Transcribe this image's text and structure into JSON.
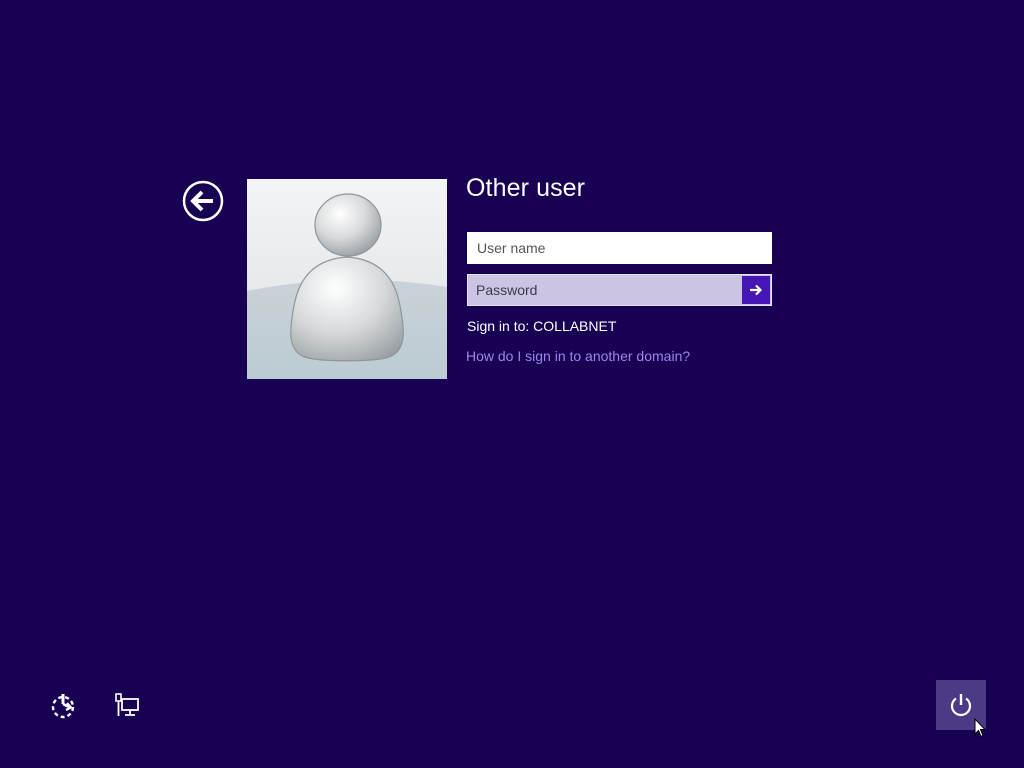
{
  "login": {
    "title": "Other user",
    "username_placeholder": "User name",
    "password_placeholder": "Password",
    "sign_in_to": "Sign in to: COLLABNET",
    "domain_help_link": "How do I sign in to another domain?"
  },
  "icons": {
    "back": "back-arrow-circle-icon",
    "avatar": "default-user-icon",
    "submit": "right-arrow-icon",
    "ease_of_access": "ease-of-access-icon",
    "network": "network-icon",
    "power": "power-icon",
    "cursor": "mouse-pointer-icon"
  },
  "colors": {
    "background": "#180052",
    "accent": "#4617b4",
    "link": "#9b86ea",
    "power_tile": "#4d3a87"
  }
}
